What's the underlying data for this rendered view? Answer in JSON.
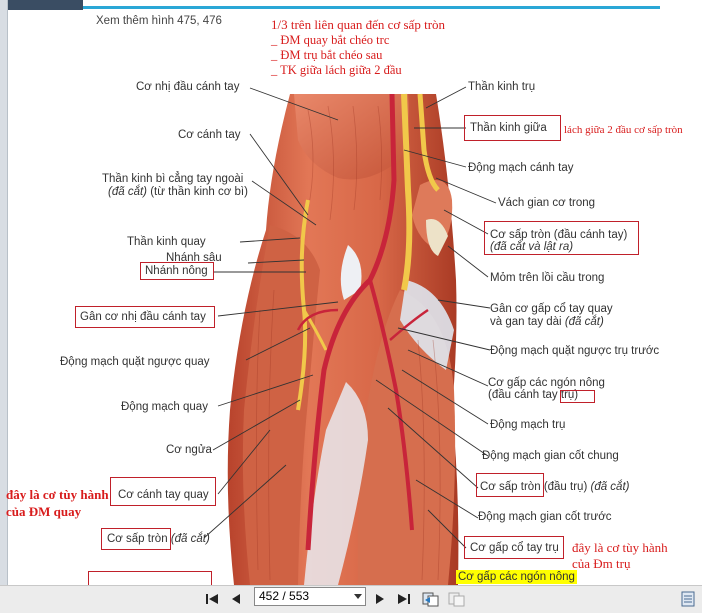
{
  "header": {
    "see_also": "Xem thêm hình 475, 476"
  },
  "notes": {
    "title": "1/3 trên liên quan đến cơ sấp tròn",
    "line1": "_ ĐM quay bắt chéo trc",
    "line2": "_ ĐM trụ bắt chéo sau",
    "line3": "_ TK giữa lách giữa 2 đầu",
    "side_note": "lách giữa 2 đầu cơ sấp tròn",
    "radial_note_1": "đây là cơ tùy hành",
    "radial_note_2": "của ĐM quay",
    "ulnar_note_1": "đây là cơ tùy hành",
    "ulnar_note_2": "của Đm trụ"
  },
  "left_labels": {
    "biceps": "Cơ nhị đầu cánh tay",
    "brachialis": "Cơ cánh tay",
    "lat_cutaneous": "Thần kinh bì cẳng tay ngoài",
    "lat_cutaneous_cut": "(đã cắt)",
    "lat_cutaneous_from": "(từ thần kinh cơ bì)",
    "radial_nerve": "Thần kinh quay",
    "deep_branch": "Nhánh sâu",
    "superficial_branch": "Nhánh nông",
    "biceps_tendon": "Gân cơ nhị đầu cánh tay",
    "radial_recurrent": "Động mạch quặt ngược quay",
    "radial_artery": "Động mạch quay",
    "supinator": "Cơ ngửa",
    "brachioradialis": "Cơ cánh tay quay",
    "pronator_teres": "Cơ sấp tròn",
    "pronator_teres_cut": "(đã cắt)"
  },
  "right_labels": {
    "ulnar_nerve": "Thần kinh trụ",
    "median_nerve": "Thần kinh giữa",
    "brachial_artery": "Động mạch cánh tay",
    "medial_septum": "Vách gian cơ trong",
    "pt_humeral_1": "Cơ sấp tròn (đầu cánh tay)",
    "pt_humeral_2": "(đã cắt và lật ra)",
    "medial_epicondyle": "Mỏm trên lồi cầu trong",
    "fcr_pl_1": "Gân cơ gấp cổ tay quay",
    "fcr_pl_2": "và gan tay dài",
    "fcr_pl_cut": "(đã cắt)",
    "ant_ulnar_recurrent": "Động mạch quặt ngược trụ trước",
    "fds_1": "Cơ gấp các ngón nông",
    "fds_2": "(đầu cánh tay",
    "fds_ulnar": "trụ)",
    "ulnar_artery": "Động mạch trụ",
    "common_interosseous": "Động mạch gian cốt chung",
    "pt_ulnar": "Cơ sấp tròn",
    "pt_ulnar_head": "(đầu trụ)",
    "pt_ulnar_cut": "(đã cắt)",
    "ant_interosseous": "Động mạch gian cốt trước",
    "fcu": "Cơ gấp cổ tay trụ",
    "fds_bottom": "Cơ gấp các ngón nông"
  },
  "toolbar": {
    "page_value": "452 / 553"
  },
  "colors": {
    "annotation": "#d81c1c",
    "highlight": "#ffff00",
    "accent": "#2aa7d6"
  }
}
